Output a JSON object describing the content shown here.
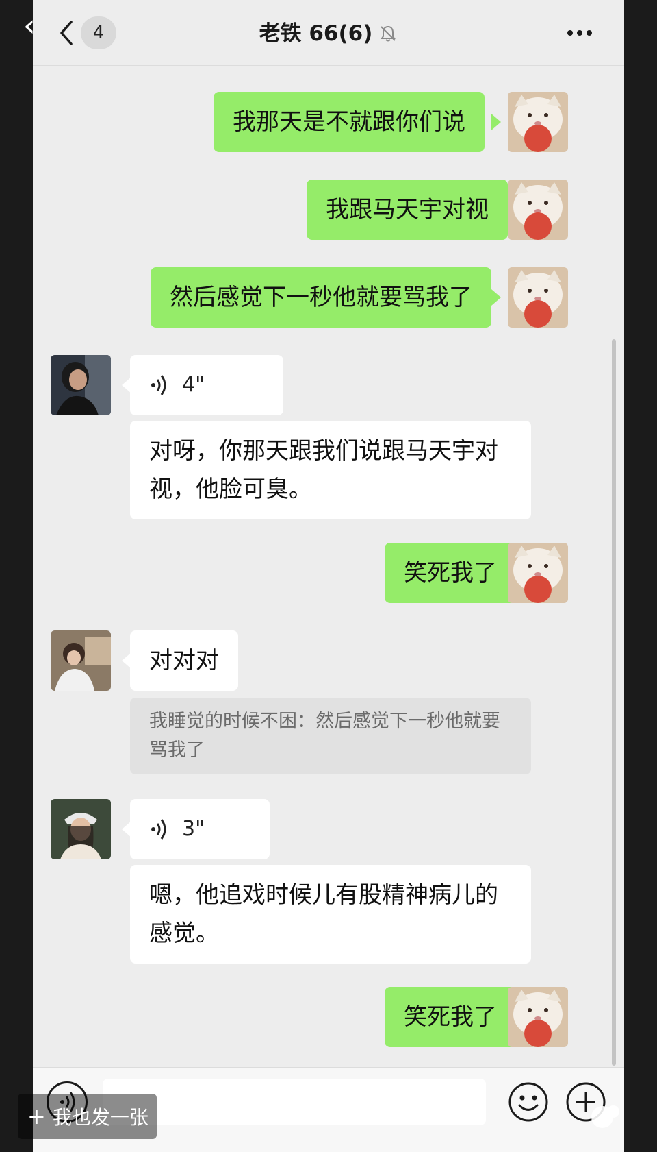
{
  "header": {
    "unread_count": "4",
    "title": "老铁 66(6)",
    "icons": [
      "back-chevron-icon",
      "mute-bell-icon",
      "more-dots-icon"
    ]
  },
  "messages": {
    "m1": "我那天是不就跟你们说",
    "m2": "我跟马天宇对视",
    "m3": "然后感觉下一秒他就要骂我了",
    "v1": "4\"",
    "m4": "对呀，你那天跟我们说跟马天宇对视，他脸可臭。",
    "m5": "笑死我了",
    "m6": "对对对",
    "quote1": "我睡觉的时候不困：然后感觉下一秒他就要骂我了",
    "v2": "3\"",
    "m7": "嗯，他追戏时候儿有股精神病儿的感觉。",
    "m8": "笑死我了"
  },
  "bottom_bar": {
    "icons": [
      "voice-input-icon",
      "emoji-icon",
      "plus-icon"
    ]
  },
  "watermark": {
    "plus": "+",
    "text": "我也发一张"
  },
  "colors": {
    "background": "#ededed",
    "outgoing_bubble": "#95ec69",
    "incoming_bubble": "#ffffff",
    "quote_bg": "#e1e1e1"
  }
}
